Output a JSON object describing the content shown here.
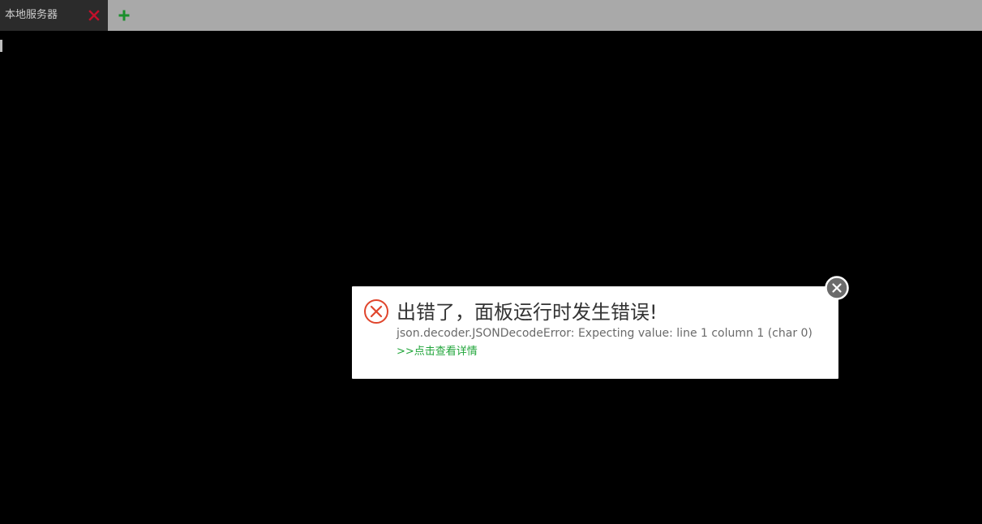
{
  "tabs": [
    {
      "label": "本地服务器",
      "close_icon": "close-icon",
      "close_color": "#c0102b"
    }
  ],
  "add_tab": {
    "icon": "plus-icon",
    "color": "#1a8f2c"
  },
  "dialog": {
    "icon": "error-circle-icon",
    "icon_color": "#e0452c",
    "title": "出错了，面板运行时发生错误!",
    "message": "json.decoder.JSONDecodeError: Expecting value: line 1 column 1 (char 0)",
    "details_link": ">>点击查看详情",
    "close_icon": "close-icon",
    "link_color": "#20a53a"
  }
}
